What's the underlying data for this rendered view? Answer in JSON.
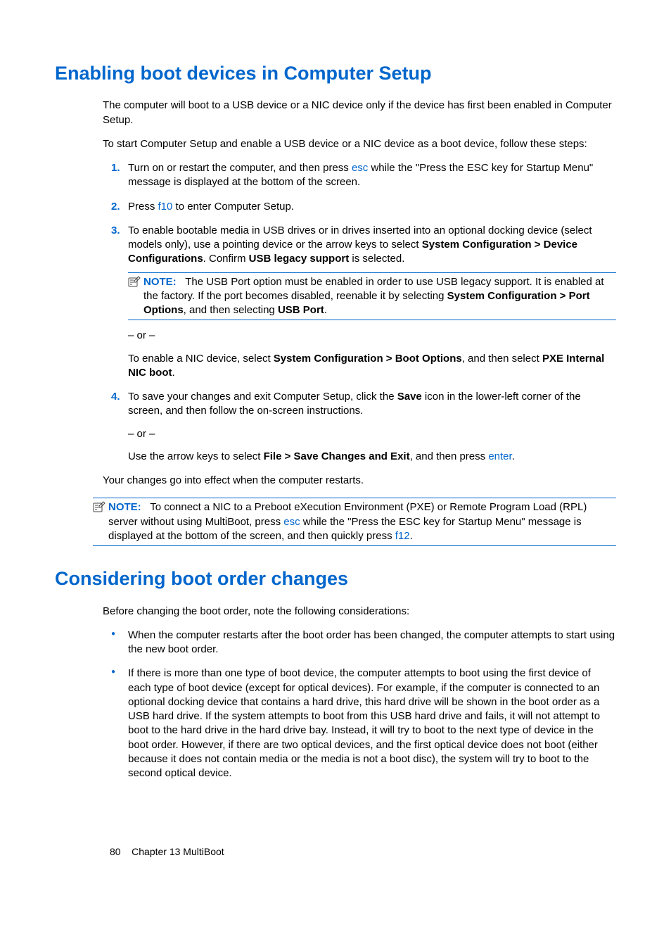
{
  "h1_section1": "Enabling boot devices in Computer Setup",
  "p_intro1": "The computer will boot to a USB device or a NIC device only if the device has first been enabled in Computer Setup.",
  "p_intro2": "To start Computer Setup and enable a USB device or a NIC device as a boot device, follow these steps:",
  "steps": {
    "s1_a": "Turn on or restart the computer, and then press ",
    "s1_key": "esc",
    "s1_b": " while the \"Press the ESC key for Startup Menu\" message is displayed at the bottom of the screen.",
    "s2_a": "Press ",
    "s2_key": "f10",
    "s2_b": " to enter Computer Setup.",
    "s3_a": "To enable bootable media in USB drives or in drives inserted into an optional docking device (select models only), use a pointing device or the arrow keys to select ",
    "s3_bold1": "System Configuration > Device Configurations",
    "s3_b": ". Confirm ",
    "s3_bold2": "USB legacy support",
    "s3_c": " is selected.",
    "note1_label": "NOTE:",
    "note1_a": "The USB Port option must be enabled in order to use USB legacy support. It is enabled at the factory. If the port becomes disabled, reenable it by selecting ",
    "note1_bold1": "System Configuration > Port Options",
    "note1_b": ", and then selecting ",
    "note1_bold2": "USB Port",
    "note1_c": ".",
    "or": "– or –",
    "s3_alt_a": "To enable a NIC device, select ",
    "s3_alt_bold1": "System Configuration > Boot Options",
    "s3_alt_b": ", and then select ",
    "s3_alt_bold2": "PXE Internal NIC boot",
    "s3_alt_c": ".",
    "s4_a": "To save your changes and exit Computer Setup, click the ",
    "s4_bold1": "Save",
    "s4_b": " icon in the lower-left corner of the screen, and then follow the on-screen instructions.",
    "s4_alt_a": "Use the arrow keys to select ",
    "s4_alt_bold1": "File > Save Changes and Exit",
    "s4_alt_b": ", and then press ",
    "s4_alt_key": "enter",
    "s4_alt_c": "."
  },
  "p_after_steps": "Your changes go into effect when the computer restarts.",
  "note2_label": "NOTE:",
  "note2_a": "To connect a NIC to a Preboot eXecution Environment (PXE) or Remote Program Load (RPL) server without using MultiBoot, press ",
  "note2_key1": "esc",
  "note2_b": " while the \"Press the ESC key for Startup Menu\" message is displayed at the bottom of the screen, and then quickly press ",
  "note2_key2": "f12",
  "note2_c": ".",
  "h1_section2": "Considering boot order changes",
  "p2_intro": "Before changing the boot order, note the following considerations:",
  "bullets": {
    "b1": "When the computer restarts after the boot order has been changed, the computer attempts to start using the new boot order.",
    "b2": "If there is more than one type of boot device, the computer attempts to boot using the first device of each type of boot device (except for optical devices). For example, if the computer is connected to an optional docking device that contains a hard drive, this hard drive will be shown in the boot order as a USB hard drive. If the system attempts to boot from this USB hard drive and fails, it will not attempt to boot to the hard drive in the hard drive bay. Instead, it will try to boot to the next type of device in the boot order. However, if there are two optical devices, and the first optical device does not boot (either because it does not contain media or the media is not a boot disc), the system will try to boot to the second optical device."
  },
  "footer_page": "80",
  "footer_chapter": "Chapter 13   MultiBoot"
}
